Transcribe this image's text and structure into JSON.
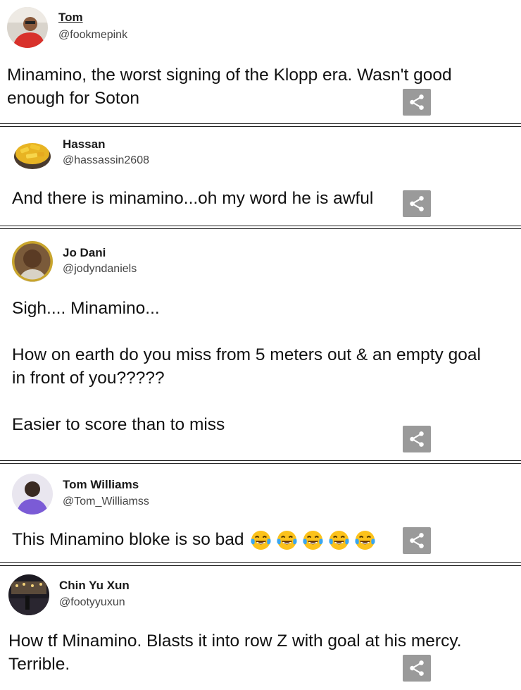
{
  "tweets": [
    {
      "name": "Tom",
      "handle": "@fookmepink",
      "text": "Minamino, the worst signing of the Klopp era. Wasn't good enough for Soton",
      "avatar_icon": "profile-photo-red-shirt"
    },
    {
      "name": "Hassan",
      "handle": "@hassassin2608",
      "text": "And there is minamino...oh my word he is awful",
      "avatar_icon": "profile-photo-food-bowl"
    },
    {
      "name": "Jo Dani",
      "handle": "@jodyndaniels",
      "text": "Sigh.... Minamino...\n\nHow on earth do you miss from 5 meters out & an empty goal in front of you?????\n\nEasier to score than to miss",
      "avatar_icon": "profile-photo-man"
    },
    {
      "name": "Tom Williams",
      "handle": "@Tom_Williamss",
      "text": "This Minamino bloke is so bad",
      "emoji": "face-with-tears-of-joy",
      "emoji_count": 5,
      "avatar_icon": "profile-photo-purple-shirt"
    },
    {
      "name": "Chin Yu Xun",
      "handle": "@footyyuxun",
      "text": "How tf Minamino. Blasts it into row Z with goal at his mercy. Terrible.",
      "avatar_icon": "profile-photo-night-street"
    }
  ],
  "share_icon": "share-icon",
  "colors": {
    "share_bg": "#9a9a9a",
    "separator": "#222222",
    "handle": "#444444"
  }
}
